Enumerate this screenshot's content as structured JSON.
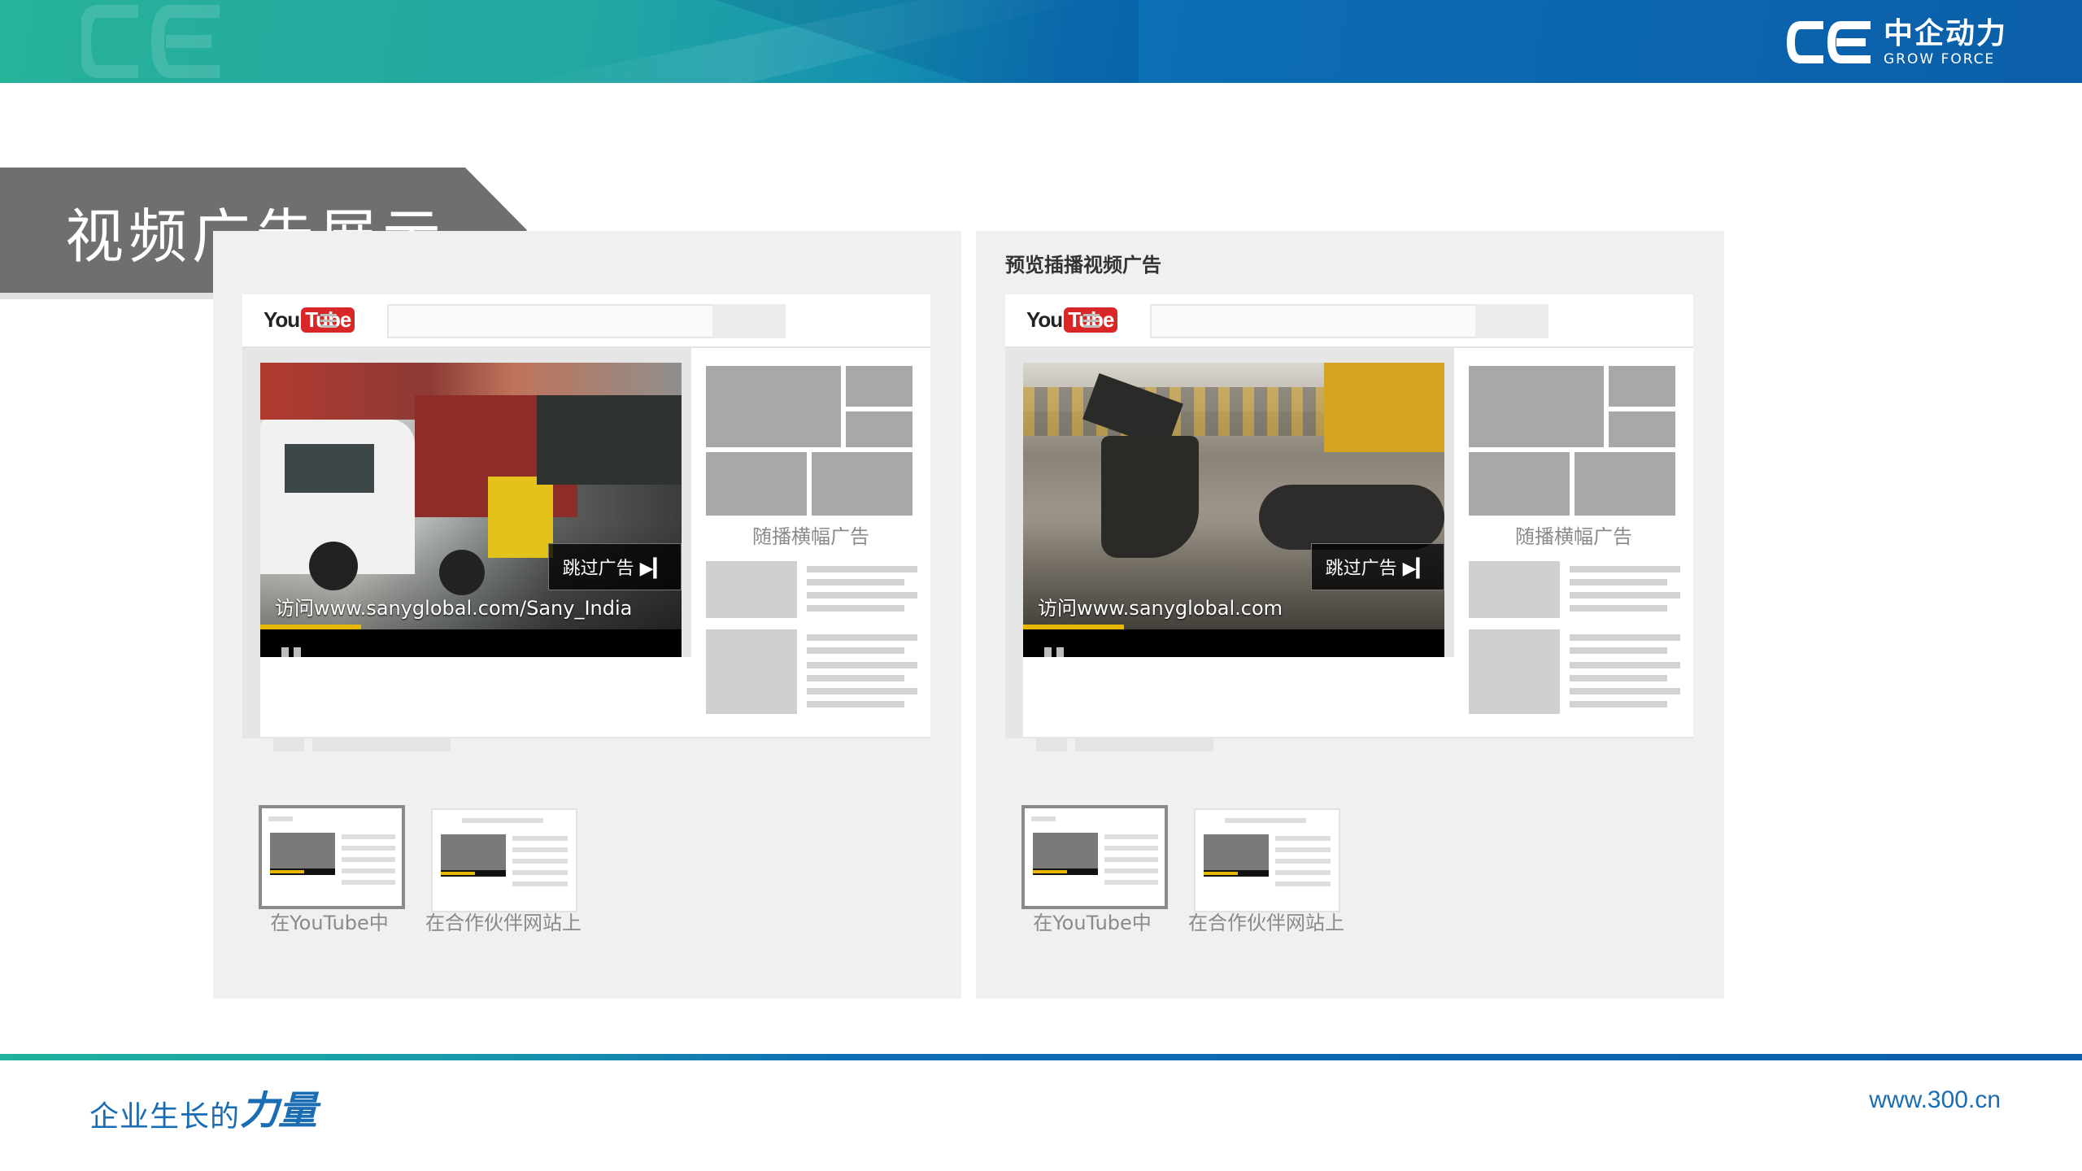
{
  "header": {
    "brand_cn": "中企动力",
    "brand_en": "GROW FORCE",
    "logo_icon": "ce-logo-icon",
    "colors": {
      "green": "#27b29a",
      "blue": "#0b5ea9"
    }
  },
  "title": "视频广告展示",
  "panels": [
    {
      "heading": "",
      "visit_text": "访问www.sanyglobal.com/Sany_India",
      "skip_label": "跳过广告 ▶▎",
      "companion_label": "随播横幅广告",
      "progress": 0.24,
      "thumbs": [
        {
          "label": "在YouTube中"
        },
        {
          "label": "在合作伙伴网站上"
        }
      ]
    },
    {
      "heading": "预览插播视频广告",
      "visit_text": "访问www.sanyglobal.com",
      "skip_label": "跳过广告 ▶▎",
      "companion_label": "随播横幅广告",
      "progress": 0.24,
      "thumbs": [
        {
          "label": "在YouTube中"
        },
        {
          "label": "在合作伙伴网站上"
        }
      ]
    }
  ],
  "youtube": {
    "you": "You",
    "tube": "Tube"
  },
  "footer": {
    "slogan_part1": "企业生长的",
    "slogan_part2": "力量",
    "website": "www.300.cn"
  }
}
